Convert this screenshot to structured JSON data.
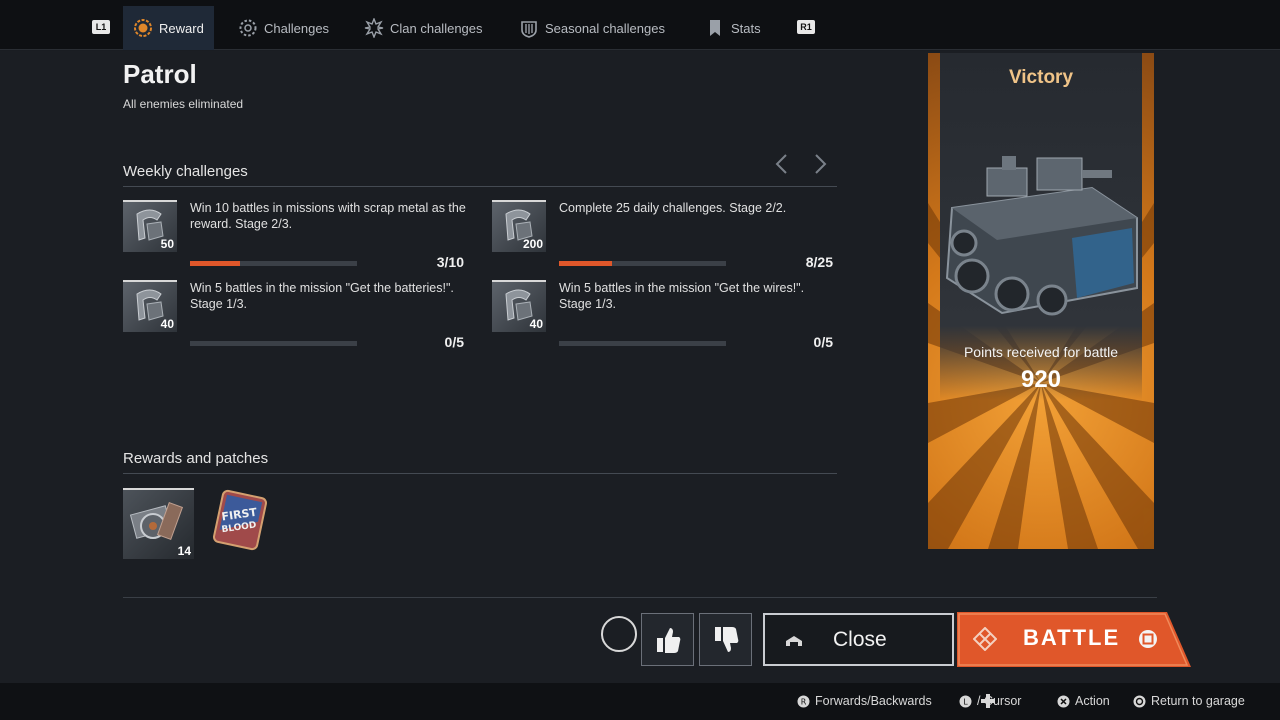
{
  "nav": {
    "left_button": "L1",
    "right_button": "R1",
    "tabs": [
      {
        "label": "Reward",
        "icon": "reward-medal-icon",
        "active": true
      },
      {
        "label": "Challenges",
        "icon": "challenges-gear-icon",
        "active": false
      },
      {
        "label": "Clan challenges",
        "icon": "clan-icon",
        "active": false
      },
      {
        "label": "Seasonal challenges",
        "icon": "seasonal-icon",
        "active": false
      },
      {
        "label": "Stats",
        "icon": "stats-bookmark-icon",
        "active": false
      }
    ]
  },
  "mission": {
    "title": "Patrol",
    "subtitle": "All enemies eliminated"
  },
  "weekly": {
    "heading": "Weekly challenges",
    "items": [
      {
        "text": "Win 10 battles in missions with scrap metal as the reward. Stage 2/3.",
        "reward": "50",
        "count": "3/10",
        "progress": 0.3
      },
      {
        "text": "Complete 25 daily challenges.  Stage 2/2.",
        "reward": "200",
        "count": "8/25",
        "progress": 0.32
      },
      {
        "text": "Win 5 battles in the mission \"Get the batteries!\". Stage 1/3.",
        "reward": "40",
        "count": "0/5",
        "progress": 0
      },
      {
        "text": "Win 5 battles in the mission \"Get the wires!\". Stage 1/3.",
        "reward": "40",
        "count": "0/5",
        "progress": 0
      }
    ]
  },
  "rewards": {
    "heading": "Rewards and patches",
    "items": [
      {
        "icon": "scrap-metal-icon",
        "count": "14"
      },
      {
        "icon": "first-blood-patch-icon",
        "patch_text_1": "FIRST",
        "patch_text_2": "BLOOD"
      }
    ]
  },
  "banner": {
    "result": "Victory",
    "points_label": "Points received for battle",
    "points": "920",
    "color": "#d4791a"
  },
  "actions": {
    "close_label": "Close",
    "battle_label": "BATTLE",
    "battle_color": "#e0572a"
  },
  "footer": {
    "hints": [
      {
        "icon": "r-stick-icon",
        "label": "Forwards/Backwards"
      },
      {
        "icon": "l-stick-dpad-icon",
        "label": "/   Cursor"
      },
      {
        "icon": "cross-button-icon",
        "label": "Action"
      },
      {
        "icon": "circle-button-icon",
        "label": "Return to garage"
      }
    ]
  }
}
